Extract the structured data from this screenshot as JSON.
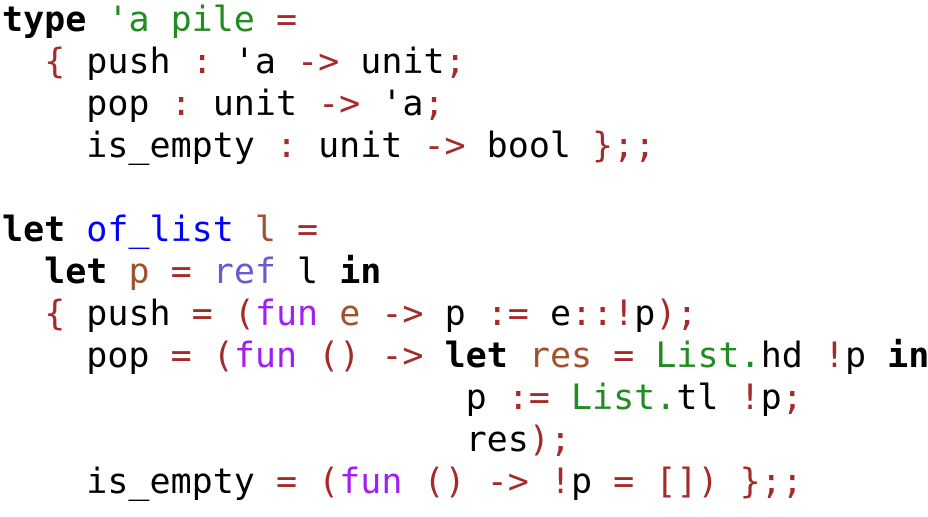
{
  "colors": {
    "keyword": "#000000",
    "symbol": "#a52a2a",
    "function_name": "#0000ff",
    "fun_keyword": "#a020f0",
    "ref": "#6a5acd",
    "module": "#228b22",
    "binding": "#a0522d",
    "type_var": "#228b22"
  },
  "lines": [
    [
      {
        "t": "type",
        "c": "kw"
      },
      {
        "t": " ",
        "c": "plain"
      },
      {
        "t": "'a pile",
        "c": "tyvar"
      },
      {
        "t": " ",
        "c": "plain"
      },
      {
        "t": "=",
        "c": "sym"
      }
    ],
    [
      {
        "t": "  ",
        "c": "plain"
      },
      {
        "t": "{",
        "c": "sym"
      },
      {
        "t": " push ",
        "c": "plain"
      },
      {
        "t": ":",
        "c": "sym"
      },
      {
        "t": " 'a ",
        "c": "plain"
      },
      {
        "t": "->",
        "c": "sym"
      },
      {
        "t": " unit",
        "c": "plain"
      },
      {
        "t": ";",
        "c": "sym"
      }
    ],
    [
      {
        "t": "    pop ",
        "c": "plain"
      },
      {
        "t": ":",
        "c": "sym"
      },
      {
        "t": " unit ",
        "c": "plain"
      },
      {
        "t": "->",
        "c": "sym"
      },
      {
        "t": " 'a",
        "c": "plain"
      },
      {
        "t": ";",
        "c": "sym"
      }
    ],
    [
      {
        "t": "    is_empty ",
        "c": "plain"
      },
      {
        "t": ":",
        "c": "sym"
      },
      {
        "t": " unit ",
        "c": "plain"
      },
      {
        "t": "->",
        "c": "sym"
      },
      {
        "t": " bool ",
        "c": "plain"
      },
      {
        "t": "};;",
        "c": "sym"
      }
    ],
    [],
    [
      {
        "t": "let",
        "c": "kw"
      },
      {
        "t": " ",
        "c": "plain"
      },
      {
        "t": "of_list",
        "c": "fn"
      },
      {
        "t": " ",
        "c": "plain"
      },
      {
        "t": "l",
        "c": "var"
      },
      {
        "t": " ",
        "c": "plain"
      },
      {
        "t": "=",
        "c": "sym"
      }
    ],
    [
      {
        "t": "  ",
        "c": "plain"
      },
      {
        "t": "let",
        "c": "kw"
      },
      {
        "t": " ",
        "c": "plain"
      },
      {
        "t": "p",
        "c": "var"
      },
      {
        "t": " ",
        "c": "plain"
      },
      {
        "t": "=",
        "c": "sym"
      },
      {
        "t": " ",
        "c": "plain"
      },
      {
        "t": "ref",
        "c": "ref"
      },
      {
        "t": " l ",
        "c": "plain"
      },
      {
        "t": "in",
        "c": "kw"
      }
    ],
    [
      {
        "t": "  ",
        "c": "plain"
      },
      {
        "t": "{",
        "c": "sym"
      },
      {
        "t": " push ",
        "c": "plain"
      },
      {
        "t": "=",
        "c": "sym"
      },
      {
        "t": " ",
        "c": "plain"
      },
      {
        "t": "(",
        "c": "sym"
      },
      {
        "t": "fun",
        "c": "fun"
      },
      {
        "t": " ",
        "c": "plain"
      },
      {
        "t": "e",
        "c": "var"
      },
      {
        "t": " ",
        "c": "plain"
      },
      {
        "t": "->",
        "c": "sym"
      },
      {
        "t": " p ",
        "c": "plain"
      },
      {
        "t": ":=",
        "c": "sym"
      },
      {
        "t": " e",
        "c": "plain"
      },
      {
        "t": "::!",
        "c": "sym"
      },
      {
        "t": "p",
        "c": "plain"
      },
      {
        "t": ");",
        "c": "sym"
      }
    ],
    [
      {
        "t": "    pop ",
        "c": "plain"
      },
      {
        "t": "=",
        "c": "sym"
      },
      {
        "t": " ",
        "c": "plain"
      },
      {
        "t": "(",
        "c": "sym"
      },
      {
        "t": "fun",
        "c": "fun"
      },
      {
        "t": " ",
        "c": "plain"
      },
      {
        "t": "()",
        "c": "sym"
      },
      {
        "t": " ",
        "c": "plain"
      },
      {
        "t": "->",
        "c": "sym"
      },
      {
        "t": " ",
        "c": "plain"
      },
      {
        "t": "let",
        "c": "kw"
      },
      {
        "t": " ",
        "c": "plain"
      },
      {
        "t": "res",
        "c": "var"
      },
      {
        "t": " ",
        "c": "plain"
      },
      {
        "t": "=",
        "c": "sym"
      },
      {
        "t": " ",
        "c": "plain"
      },
      {
        "t": "List.",
        "c": "mod"
      },
      {
        "t": "hd ",
        "c": "plain"
      },
      {
        "t": "!",
        "c": "sym"
      },
      {
        "t": "p ",
        "c": "plain"
      },
      {
        "t": "in",
        "c": "kw"
      }
    ],
    [
      {
        "t": "                      p ",
        "c": "plain"
      },
      {
        "t": ":=",
        "c": "sym"
      },
      {
        "t": " ",
        "c": "plain"
      },
      {
        "t": "List.",
        "c": "mod"
      },
      {
        "t": "tl ",
        "c": "plain"
      },
      {
        "t": "!",
        "c": "sym"
      },
      {
        "t": "p",
        "c": "plain"
      },
      {
        "t": ";",
        "c": "sym"
      }
    ],
    [
      {
        "t": "                      res",
        "c": "plain"
      },
      {
        "t": ");",
        "c": "sym"
      }
    ],
    [
      {
        "t": "    is_empty ",
        "c": "plain"
      },
      {
        "t": "=",
        "c": "sym"
      },
      {
        "t": " ",
        "c": "plain"
      },
      {
        "t": "(",
        "c": "sym"
      },
      {
        "t": "fun",
        "c": "fun"
      },
      {
        "t": " ",
        "c": "plain"
      },
      {
        "t": "()",
        "c": "sym"
      },
      {
        "t": " ",
        "c": "plain"
      },
      {
        "t": "->",
        "c": "sym"
      },
      {
        "t": " ",
        "c": "plain"
      },
      {
        "t": "!",
        "c": "sym"
      },
      {
        "t": "p ",
        "c": "plain"
      },
      {
        "t": "=",
        "c": "sym"
      },
      {
        "t": " ",
        "c": "plain"
      },
      {
        "t": "[])",
        "c": "sym"
      },
      {
        "t": " ",
        "c": "plain"
      },
      {
        "t": "};;",
        "c": "sym"
      }
    ]
  ]
}
